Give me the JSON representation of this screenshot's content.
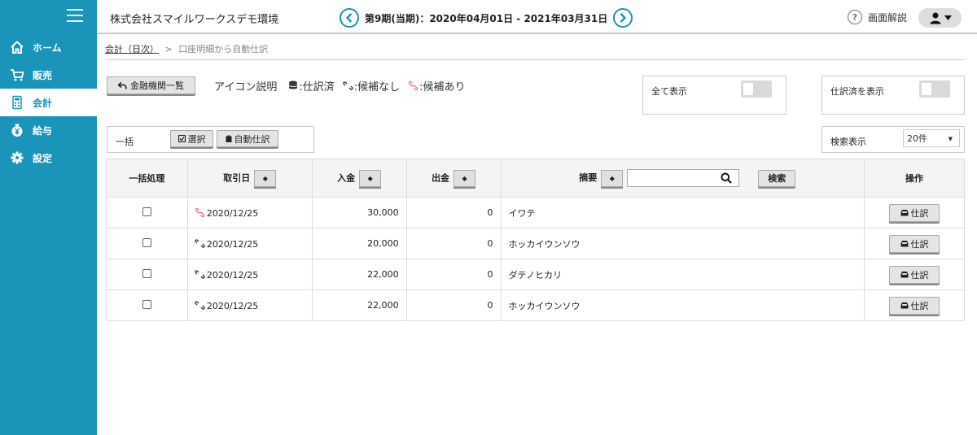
{
  "sidebar": {
    "items": [
      {
        "label": "ホーム",
        "icon": "home-icon"
      },
      {
        "label": "販売",
        "icon": "cart-icon"
      },
      {
        "label": "会計",
        "icon": "calculator-icon"
      },
      {
        "label": "給与",
        "icon": "yen-bag-icon"
      },
      {
        "label": "設定",
        "icon": "gear-icon"
      }
    ],
    "active_index": 2
  },
  "header": {
    "company": "株式会社スマイルワークスデモ環境",
    "period": "第9期(当期)：2020年04月01日 - 2021年03月31日",
    "help_label": "画面解説"
  },
  "breadcrumb": {
    "parent": "会計（日次）",
    "separator": ">",
    "current": "口座明細から自動仕訳"
  },
  "toolbar": {
    "bank_button": "金融機関一覧",
    "legend_title": "アイコン説明",
    "legend_done": ":仕訳済",
    "legend_none": ":候補なし",
    "legend_some": ":候補あり"
  },
  "filters": {
    "show_all_label": "全て表示",
    "show_all_on": false,
    "show_journaled_label": "仕訳済を表示",
    "show_journaled_on": false,
    "bulk_label": "一括",
    "select_button": "選択",
    "auto_journal_button": "自動仕訳",
    "page_size_label": "検索表示",
    "page_size_value": "20件"
  },
  "table": {
    "headers": {
      "bulk": "一括処理",
      "date": "取引日",
      "deposit": "入金",
      "withdrawal": "出金",
      "summary": "摘要",
      "search_button": "検索",
      "action": "操作"
    },
    "search_placeholder": "",
    "action_button": "仕訳",
    "rows": [
      {
        "status": "has-candidates",
        "date": "2020/12/25",
        "deposit": "30,000",
        "withdrawal": "0",
        "summary": "イワテ"
      },
      {
        "status": "no-candidates",
        "date": "2020/12/25",
        "deposit": "20,000",
        "withdrawal": "0",
        "summary": "ホッカイウンソウ"
      },
      {
        "status": "no-candidates",
        "date": "2020/12/25",
        "deposit": "22,000",
        "withdrawal": "0",
        "summary": "ダテノヒカリ"
      },
      {
        "status": "no-candidates",
        "date": "2020/12/25",
        "deposit": "22,000",
        "withdrawal": "0",
        "summary": "ホッカイウンソウ"
      }
    ]
  },
  "colors": {
    "sidebar": "#1a94b8",
    "has_candidates": "#e67a7a"
  }
}
